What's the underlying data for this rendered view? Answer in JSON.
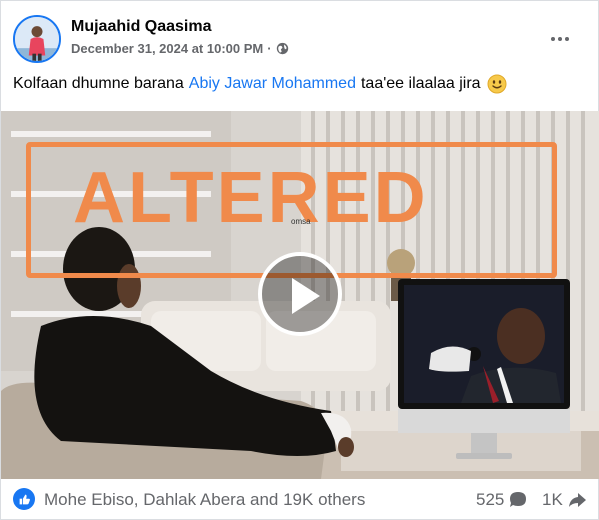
{
  "post": {
    "author": "Mujaahid Qaasima",
    "date": "December 31, 2024 at 10:00 PM",
    "separator": "·",
    "text_before": "Kolfaan dhumne barana",
    "mention": "Abiy Jawar Mohammed",
    "text_after": "taa'ee ilaalaa jira",
    "emoji": "slightly-smiling-face"
  },
  "media": {
    "overlay_label": "ALTERED",
    "watermark": "omsa",
    "overlay_color": "#f08a4b"
  },
  "footer": {
    "reactors": "Mohe Ebiso, Dahlak Abera and 19K others",
    "comments_count": "525",
    "shares_count": "1K"
  },
  "colors": {
    "brand": "#1877f2",
    "secondary_text": "#65676b"
  },
  "icons": {
    "privacy": "globe-icon",
    "menu": "more-icon",
    "reaction": "like-icon",
    "comment": "comment-icon",
    "share": "share-icon",
    "play": "play-icon"
  }
}
